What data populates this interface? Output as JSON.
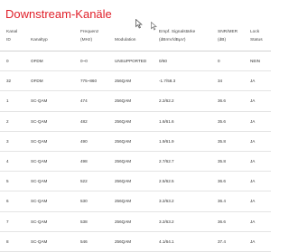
{
  "page": {
    "title": "Downstream-Kanäle"
  },
  "table": {
    "headers": [
      [
        "Kanal",
        "ID"
      ],
      [
        "",
        "Kanaltyp"
      ],
      [
        "Frequenz",
        "(MHz)"
      ],
      [
        "",
        "Modulation"
      ],
      [
        "Empf. Signalstärke",
        "(dBmV/dBµV)"
      ],
      [
        "SNR/MER",
        "(dB)"
      ],
      [
        "Lock",
        "Status"
      ]
    ],
    "rows": [
      [
        "0",
        "OFDM",
        "0~0",
        "UNSUPPORTED",
        "0/60",
        "0",
        "NEIN"
      ],
      [
        "32",
        "OFDM",
        "775~860",
        "256QAM",
        "-1.7/58.3",
        "34",
        "JA"
      ],
      [
        "1",
        "SC-QAM",
        "474",
        "256QAM",
        "2.2/62.2",
        "36.6",
        "JA"
      ],
      [
        "2",
        "SC-QAM",
        "482",
        "256QAM",
        "1.6/61.6",
        "35.6",
        "JA"
      ],
      [
        "3",
        "SC-QAM",
        "490",
        "256QAM",
        "1.9/61.9",
        "35.8",
        "JA"
      ],
      [
        "4",
        "SC-QAM",
        "498",
        "256QAM",
        "2.7/62.7",
        "35.8",
        "JA"
      ],
      [
        "5",
        "SC-QAM",
        "522",
        "256QAM",
        "2.5/62.5",
        "36.6",
        "JA"
      ],
      [
        "6",
        "SC-QAM",
        "530",
        "256QAM",
        "3.2/63.2",
        "36.4",
        "JA"
      ],
      [
        "7",
        "SC-QAM",
        "538",
        "256QAM",
        "3.2/63.2",
        "36.6",
        "JA"
      ],
      [
        "8",
        "SC-QAM",
        "546",
        "256QAM",
        "4.1/64.1",
        "37.4",
        "JA"
      ]
    ]
  },
  "colors": {
    "title": "#e0202a",
    "text": "#333333",
    "row_border": "#e4e4e4"
  },
  "icons": {
    "cursors": [
      "cursor-arrow-icon",
      "cursor-arrow-icon"
    ]
  }
}
